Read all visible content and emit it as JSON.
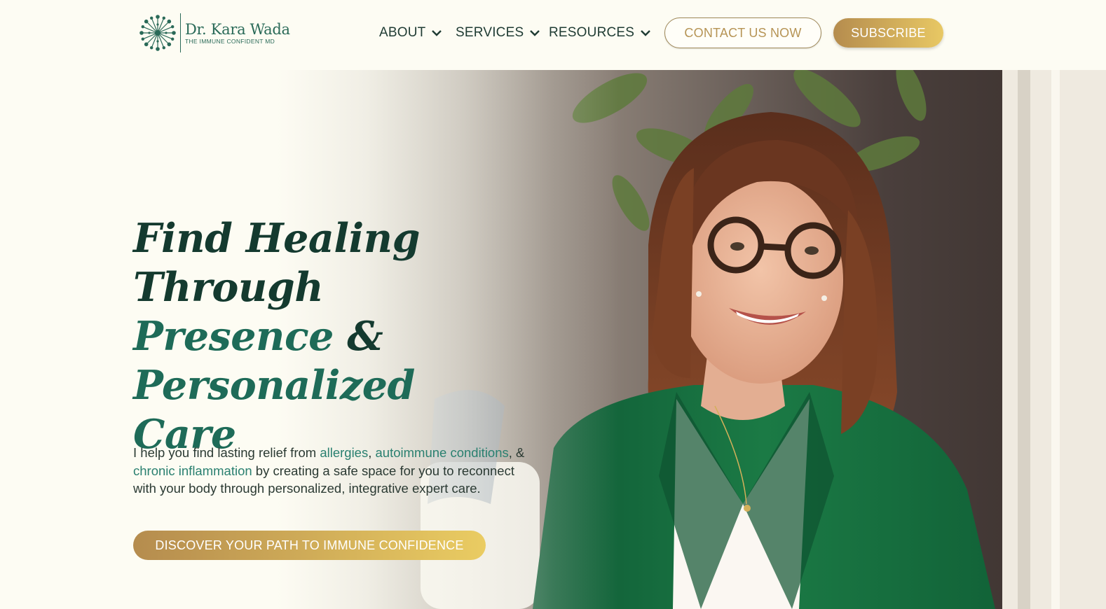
{
  "brand": {
    "name": "Dr. Kara Wada",
    "tagline": "THE IMMUNE CONFIDENT MD",
    "logo_icon": "dandelion-icon",
    "color_primary": "#1e6b58",
    "color_gold": "#c9a55a"
  },
  "nav": {
    "items": [
      {
        "label": "ABOUT",
        "icon": "chevron-down-icon"
      },
      {
        "label": "SERVICES",
        "icon": "chevron-down-icon"
      },
      {
        "label": "RESOURCES",
        "icon": "chevron-down-icon"
      }
    ],
    "contact_label": "CONTACT US NOW",
    "subscribe_label": "SUBSCRIBE"
  },
  "hero": {
    "headline_1": "Find Healing",
    "headline_2": "Through ",
    "headline_accent_1": "Presence ",
    "headline_3": "&",
    "headline_accent_2": "Personalized Care",
    "intro_1": "I help you find lasting relief from ",
    "link_allergies": "allergies",
    "sep_1": ", ",
    "link_autoimmune": "autoimmune conditions",
    "sep_2": ", & ",
    "link_inflammation": "chronic inflammation",
    "intro_2": " by creating a safe space for you to reconnect with your body through personalized, integrative expert care.",
    "cta_label": "DISCOVER YOUR PATH TO IMMUNE CONFIDENCE",
    "photo_description_icon": "portrait-photo"
  }
}
